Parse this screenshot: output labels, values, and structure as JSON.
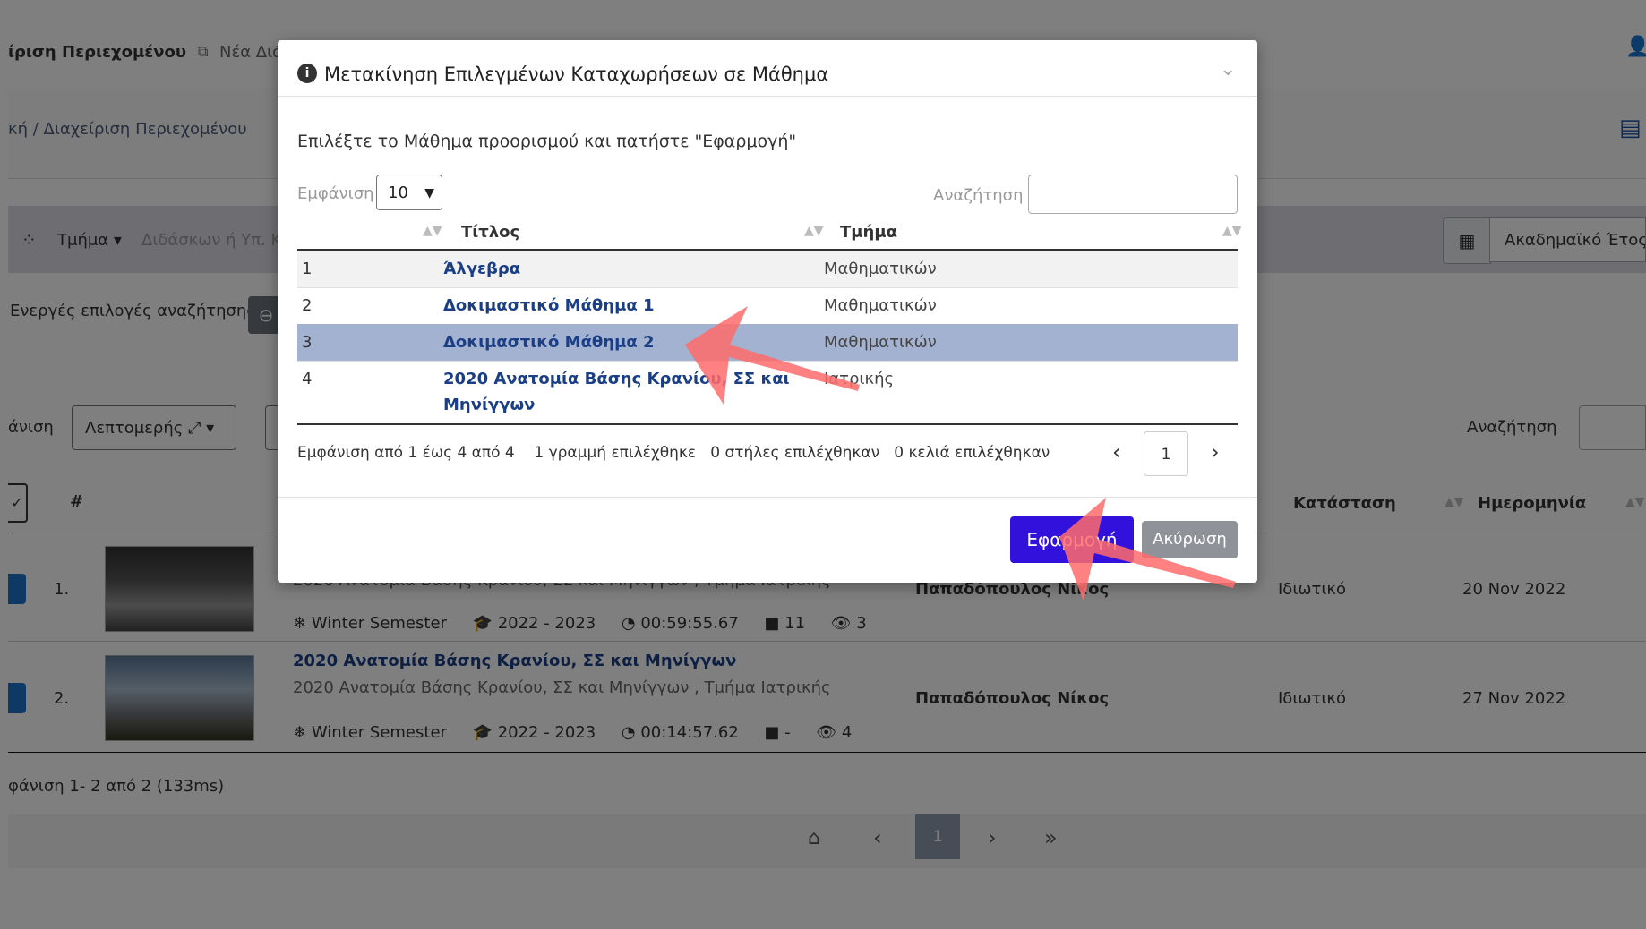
{
  "page": {
    "header_title": "ίριση Περιεχομένου",
    "header_new": "Νέα Διά",
    "breadcrumb": "κή  /  Διαχείριση Περιεχομένου",
    "filter_tmima": "Τμήμα",
    "filter_didaskon": "Διδάσκων ή Υπ. Κ",
    "academic_year": "Ακαδημαϊκό Έτος:",
    "active_filters": "Ενεργές επιλογές αναζήτησης",
    "view_label": "άνιση",
    "view_select": "Λεπτομερής",
    "search_label": "Αναζήτηση",
    "col_hash": "#",
    "col_status": "Κατάσταση",
    "col_date": "Ημερομηνία",
    "rows": [
      {
        "num": "1.",
        "title": "2020 Ανατομία Βάσης Κρανίου, ΣΣ και Μηνίγγων , Τμήμα Ιατρικής",
        "subtitle": "",
        "owner": "Παπαδόπουλος Νίκος",
        "status": "Ιδιωτικό",
        "date": "20 Nov 2022",
        "semester": "Winter Semester",
        "year": "2022 - 2023",
        "duration": "00:59:55.67",
        "comments": "11",
        "views": "3"
      },
      {
        "num": "2.",
        "title": "2020 Ανατομία Βάσης Κρανίου, ΣΣ και Μηνίγγων",
        "subtitle": "2020 Ανατομία Βάσης Κρανίου, ΣΣ και Μηνίγγων , Τμήμα Ιατρικής",
        "owner": "Παπαδόπουλος Νίκος",
        "status": "Ιδιωτικό",
        "date": "27 Nov 2022",
        "semester": "Winter Semester",
        "year": "2022 - 2023",
        "duration": "00:14:57.62",
        "comments": "-",
        "views": "4"
      }
    ],
    "results_info": "φάνιση 1- 2 από 2 (133ms)",
    "pager_current": "1"
  },
  "modal": {
    "title": "Μετακίνηση Επιλεγμένων Καταχωρήσεων σε Μάθημα",
    "instruction": "Επιλέξτε το Μάθημα προορισμού και πατήστε \"Εφαρμογή\"",
    "show_label": "Εμφάνιση",
    "show_value": "10",
    "search_label": "Αναζήτηση",
    "search_value": "",
    "col_title": "Τίτλος",
    "col_dept": "Τμήμα",
    "rows": [
      {
        "n": "1",
        "title": "Άλγεβρα",
        "title2": "",
        "dept": "Μαθηματικών"
      },
      {
        "n": "2",
        "title": "Δοκιμαστικό Μάθημα 1",
        "title2": "",
        "dept": "Μαθηματικών"
      },
      {
        "n": "3",
        "title": "Δοκιμαστικό Μάθημα 2",
        "title2": "",
        "dept": "Μαθηματικών"
      },
      {
        "n": "4",
        "title": "2020 Ανατομία Βάσης Κρανίου, ΣΣ και",
        "title2": "Μηνίγγων",
        "dept": "Ιατρικής"
      }
    ],
    "info": "Εμφάνιση από 1 έως 4 από 4",
    "selected_rows": "1 γραμμή επιλέχθηκε",
    "selected_cols": "0 στήλες επιλέχθηκαν",
    "selected_cells": "0 κελιά επιλέχθηκαν",
    "page": "1",
    "apply": "Εφαρμογή",
    "cancel": "Ακύρωση"
  },
  "colors": {
    "apply_button": "#3311dd",
    "selected_row": "#a3b2d0",
    "link": "#1b3f86",
    "annotation_arrow": "#ff6b6b"
  }
}
